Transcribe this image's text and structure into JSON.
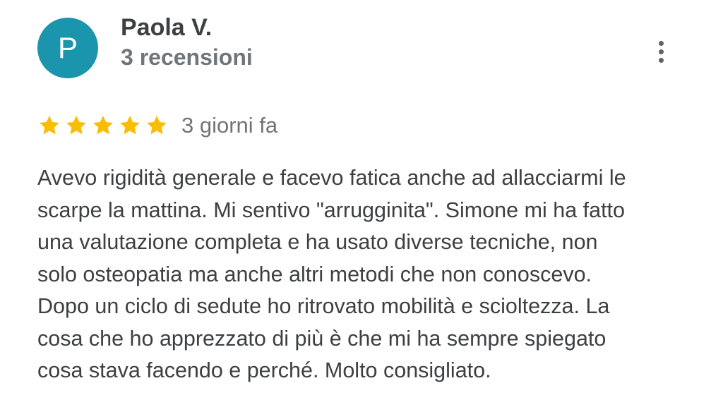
{
  "reviewer": {
    "avatar_initial": "P",
    "avatar_color": "#1b95ad",
    "name": "Paola V.",
    "review_count": "3 recensioni"
  },
  "review": {
    "rating": 5,
    "rating_max": 5,
    "date": "3 giorni fa",
    "text": "Avevo rigidità generale e facevo fatica anche ad allacciarmi le\nscarpe la mattina. Mi sentivo \"arrugginita\". Simone mi ha fatto\nuna valutazione completa e ha usato diverse tecniche, non\nsolo osteopatia ma anche altri metodi che non conoscevo.\nDopo un ciclo di sedute ho ritrovato mobilità e scioltezza. La\ncosa che ho apprezzato di più è che mi ha sempre spiegato\ncosa stava facendo e perché. Molto consigliato."
  },
  "icons": {
    "star": "star-icon",
    "more": "more-vertical-icon"
  },
  "colors": {
    "star_filled": "#fbbc04",
    "star_empty": "#dadce0",
    "text_primary": "#3c4043",
    "text_secondary": "#70757a"
  }
}
